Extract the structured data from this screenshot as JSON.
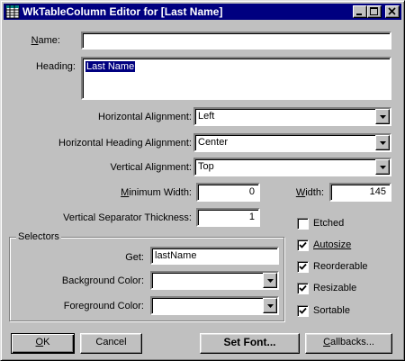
{
  "window": {
    "title": "WkTableColumn Editor for [Last Name]",
    "minimize_icon": "minimize-icon",
    "maximize_icon": "maximize-icon",
    "close_icon": "close-icon"
  },
  "form": {
    "name_label": "Name:",
    "name_value": "",
    "heading_label": "Heading:",
    "heading_value": "Last Name",
    "h_align_label": "Horizontal Alignment:",
    "h_align_value": "Left",
    "h_heading_align_label": "Horizontal Heading Alignment:",
    "h_heading_align_value": "Center",
    "v_align_label": "Vertical Alignment:",
    "v_align_value": "Top",
    "min_width_label": "Minimum Width:",
    "min_width_value": "0",
    "width_label": "Width:",
    "width_value": "145",
    "v_sep_label": "Vertical Separator Thickness:",
    "v_sep_value": "1"
  },
  "selectors": {
    "group_title": "Selectors",
    "get_label": "Get:",
    "get_value": "lastName",
    "bg_color_label": "Background Color:",
    "bg_color_value": "",
    "fg_color_label": "Foreground Color:",
    "fg_color_value": ""
  },
  "options": [
    {
      "label": "Etched",
      "checked": false
    },
    {
      "label": "Autosize",
      "checked": true
    },
    {
      "label": "Reorderable",
      "checked": true
    },
    {
      "label": "Resizable",
      "checked": true
    },
    {
      "label": "Sortable",
      "checked": true
    }
  ],
  "buttons": {
    "ok": "OK",
    "cancel": "Cancel",
    "set_font": "Set Font...",
    "callbacks": "Callbacks..."
  },
  "colors": {
    "titlebar": "#000080",
    "face": "#c0c0c0",
    "selection": "#000080"
  }
}
